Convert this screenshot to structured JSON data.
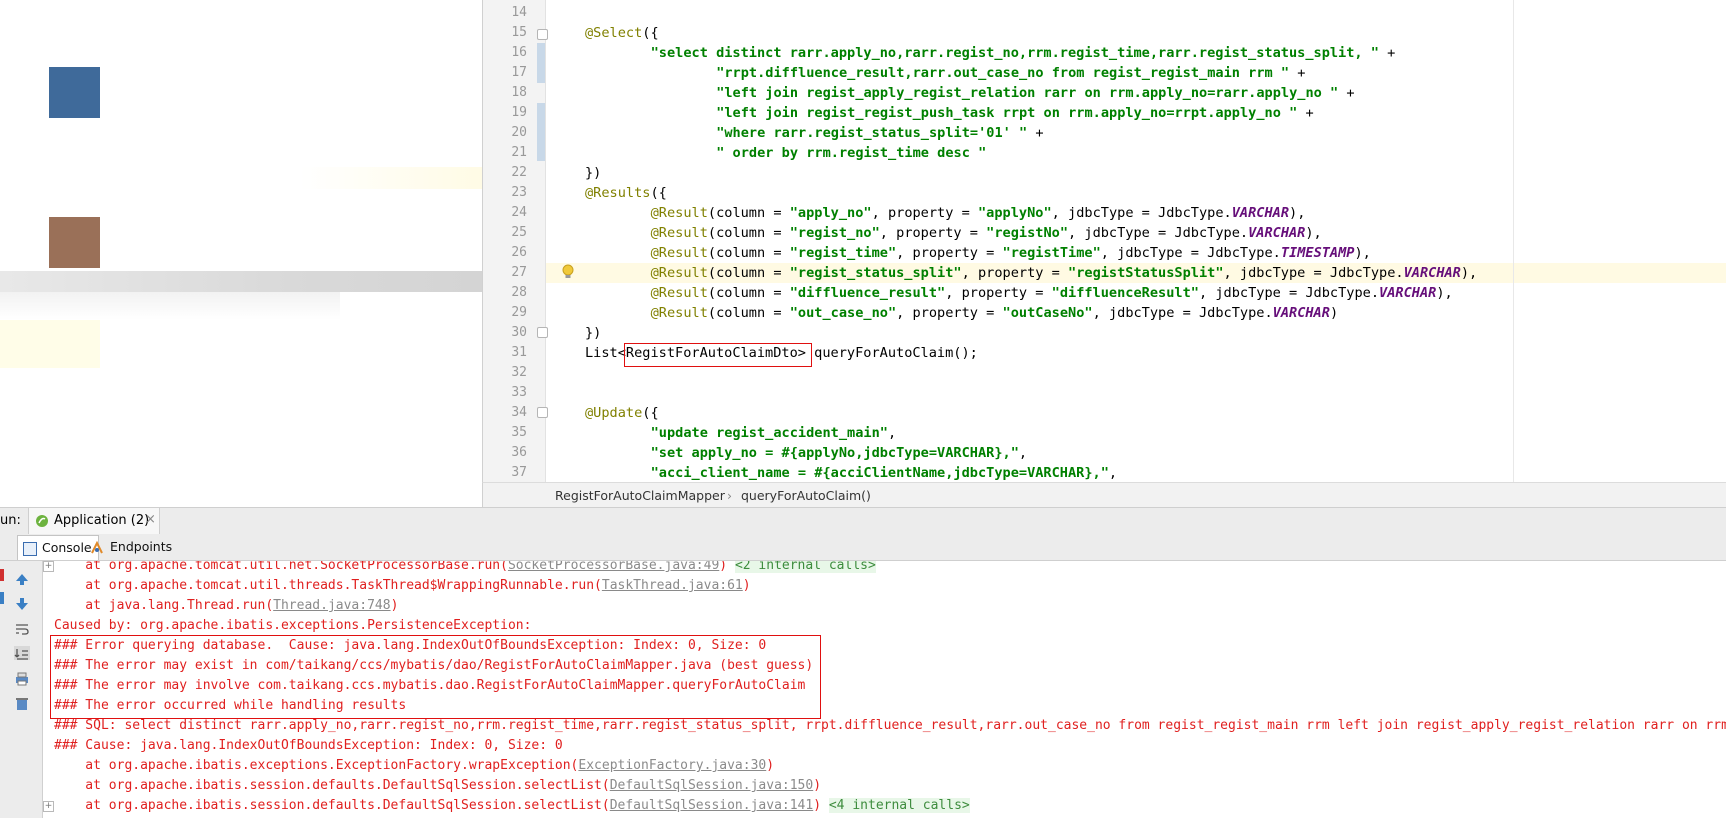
{
  "editor": {
    "lines": [
      {
        "n": "14",
        "parts": []
      },
      {
        "n": "15",
        "parts": [
          {
            "t": "@Select",
            "c": "ann"
          },
          {
            "t": "({",
            "c": ""
          }
        ]
      },
      {
        "n": "16",
        "indent": 8,
        "parts": [
          {
            "t": "\"select distinct rarr.apply_no,rarr.regist_no,rrm.regist_time,rarr.regist_status_split, \"",
            "c": "str"
          },
          {
            "t": " +",
            "c": ""
          }
        ]
      },
      {
        "n": "17",
        "indent": 16,
        "parts": [
          {
            "t": "\"rrpt.diffluence_result,rarr.out_case_no from regist_regist_main rrm \"",
            "c": "str"
          },
          {
            "t": " +",
            "c": ""
          }
        ]
      },
      {
        "n": "18",
        "indent": 16,
        "parts": [
          {
            "t": "\"left join regist_apply_regist_relation rarr on rrm.apply_no=rarr.apply_no \"",
            "c": "str"
          },
          {
            "t": " +",
            "c": ""
          }
        ]
      },
      {
        "n": "19",
        "indent": 16,
        "parts": [
          {
            "t": "\"left join regist_regist_push_task rrpt on rrm.apply_no=rrpt.apply_no \"",
            "c": "str"
          },
          {
            "t": " +",
            "c": ""
          }
        ]
      },
      {
        "n": "20",
        "indent": 16,
        "parts": [
          {
            "t": "\"where rarr.regist_status_split='01' \"",
            "c": "str"
          },
          {
            "t": " +",
            "c": ""
          }
        ]
      },
      {
        "n": "21",
        "indent": 16,
        "parts": [
          {
            "t": "\" order by rrm.regist_time desc \"",
            "c": "str"
          }
        ]
      },
      {
        "n": "22",
        "parts": [
          {
            "t": "})",
            "c": ""
          }
        ]
      },
      {
        "n": "23",
        "parts": [
          {
            "t": "@Results",
            "c": "ann"
          },
          {
            "t": "({",
            "c": ""
          }
        ]
      },
      {
        "n": "24",
        "indent": 8,
        "parts": [
          {
            "t": "@Result",
            "c": "ann"
          },
          {
            "t": "(column = ",
            "c": ""
          },
          {
            "t": "\"apply_no\"",
            "c": "str"
          },
          {
            "t": ", property = ",
            "c": ""
          },
          {
            "t": "\"applyNo\"",
            "c": "str"
          },
          {
            "t": ", jdbcType = JdbcType.",
            "c": ""
          },
          {
            "t": "VARCHAR",
            "c": "const"
          },
          {
            "t": "),",
            "c": ""
          }
        ]
      },
      {
        "n": "25",
        "indent": 8,
        "parts": [
          {
            "t": "@Result",
            "c": "ann"
          },
          {
            "t": "(column = ",
            "c": ""
          },
          {
            "t": "\"regist_no\"",
            "c": "str"
          },
          {
            "t": ", property = ",
            "c": ""
          },
          {
            "t": "\"registNo\"",
            "c": "str"
          },
          {
            "t": ", jdbcType = JdbcType.",
            "c": ""
          },
          {
            "t": "VARCHAR",
            "c": "const"
          },
          {
            "t": "),",
            "c": ""
          }
        ]
      },
      {
        "n": "26",
        "indent": 8,
        "parts": [
          {
            "t": "@Result",
            "c": "ann"
          },
          {
            "t": "(column = ",
            "c": ""
          },
          {
            "t": "\"regist_time\"",
            "c": "str"
          },
          {
            "t": ", property = ",
            "c": ""
          },
          {
            "t": "\"registTime\"",
            "c": "str"
          },
          {
            "t": ", jdbcType = JdbcType.",
            "c": ""
          },
          {
            "t": "TIMESTAMP",
            "c": "const"
          },
          {
            "t": "),",
            "c": ""
          }
        ]
      },
      {
        "n": "27",
        "indent": 8,
        "parts": [
          {
            "t": "@Result",
            "c": "ann"
          },
          {
            "t": "(column = ",
            "c": ""
          },
          {
            "t": "\"regist_status_split\"",
            "c": "str"
          },
          {
            "t": ", property = ",
            "c": ""
          },
          {
            "t": "\"registStatusSplit\"",
            "c": "str"
          },
          {
            "t": ", jdbcType = JdbcType.",
            "c": ""
          },
          {
            "t": "VARCHAR",
            "c": "const"
          },
          {
            "t": "),",
            "c": ""
          }
        ]
      },
      {
        "n": "28",
        "indent": 8,
        "parts": [
          {
            "t": "@Result",
            "c": "ann"
          },
          {
            "t": "(column = ",
            "c": ""
          },
          {
            "t": "\"diffluence_result\"",
            "c": "str"
          },
          {
            "t": ", property = ",
            "c": ""
          },
          {
            "t": "\"diffluenceResult\"",
            "c": "str"
          },
          {
            "t": ", jdbcType = JdbcType.",
            "c": ""
          },
          {
            "t": "VARCHAR",
            "c": "const"
          },
          {
            "t": "),",
            "c": ""
          }
        ]
      },
      {
        "n": "29",
        "indent": 8,
        "parts": [
          {
            "t": "@Result",
            "c": "ann"
          },
          {
            "t": "(column = ",
            "c": ""
          },
          {
            "t": "\"out_case_no\"",
            "c": "str"
          },
          {
            "t": ", property = ",
            "c": ""
          },
          {
            "t": "\"outCaseNo\"",
            "c": "str"
          },
          {
            "t": ", jdbcType = JdbcType.",
            "c": ""
          },
          {
            "t": "VARCHAR",
            "c": "const"
          },
          {
            "t": ")",
            "c": ""
          }
        ]
      },
      {
        "n": "30",
        "parts": [
          {
            "t": "})",
            "c": ""
          }
        ]
      },
      {
        "n": "31",
        "parts": [
          {
            "t": "List<",
            "c": ""
          },
          {
            "t": "RegistForAutoClaimDto",
            "c": ""
          },
          {
            "t": "> queryForAutoClaim();",
            "c": ""
          }
        ]
      },
      {
        "n": "32",
        "parts": []
      },
      {
        "n": "33",
        "parts": []
      },
      {
        "n": "34",
        "parts": [
          {
            "t": "@Update",
            "c": "ann"
          },
          {
            "t": "({",
            "c": ""
          }
        ]
      },
      {
        "n": "35",
        "indent": 8,
        "parts": [
          {
            "t": "\"update regist_accident_main\"",
            "c": "str"
          },
          {
            "t": ",",
            "c": ""
          }
        ]
      },
      {
        "n": "36",
        "indent": 8,
        "parts": [
          {
            "t": "\"set apply_no = #{applyNo,jdbcType=VARCHAR},\"",
            "c": "str"
          },
          {
            "t": ",",
            "c": ""
          }
        ]
      },
      {
        "n": "37",
        "indent": 8,
        "parts": [
          {
            "t": "\"acci_client_name = #{acciClientName,jdbcType=VARCHAR},\"",
            "c": "str"
          },
          {
            "t": ",",
            "c": ""
          }
        ]
      }
    ]
  },
  "breadcrumb": {
    "items": [
      "RegistForAutoClaimMapper",
      "queryForAutoClaim()"
    ],
    "separator": "›"
  },
  "run": {
    "label": "un:",
    "app_tab": "Application (2)",
    "close": "×"
  },
  "tabs": {
    "console": "Console",
    "endpoints": "Endpoints"
  },
  "console": {
    "lines": [
      {
        "parts": [
          {
            "t": "    at org.apache.tomcat.util.net.SocketProcessorBase.run(",
            "c": ""
          },
          {
            "t": "SocketProcessorBase.java:49",
            "c": "link"
          },
          {
            "t": ") ",
            "c": ""
          },
          {
            "t": "<2 internal calls>",
            "c": "internal"
          }
        ],
        "fold": true
      },
      {
        "parts": [
          {
            "t": "    at org.apache.tomcat.util.threads.TaskThread$WrappingRunnable.run(",
            "c": ""
          },
          {
            "t": "TaskThread.java:61",
            "c": "link"
          },
          {
            "t": ")",
            "c": ""
          }
        ]
      },
      {
        "parts": [
          {
            "t": "    at java.lang.Thread.run(",
            "c": ""
          },
          {
            "t": "Thread.java:748",
            "c": "link"
          },
          {
            "t": ")",
            "c": ""
          }
        ]
      },
      {
        "parts": [
          {
            "t": "Caused by: org.apache.ibatis.exceptions.PersistenceException:",
            "c": ""
          }
        ]
      },
      {
        "parts": [
          {
            "t": "### Error querying database.  Cause: java.lang.IndexOutOfBoundsException: Index: 0, Size: 0",
            "c": ""
          }
        ]
      },
      {
        "parts": [
          {
            "t": "### The error may exist in com/taikang/ccs/mybatis/dao/RegistForAutoClaimMapper.java (best guess)",
            "c": ""
          }
        ]
      },
      {
        "parts": [
          {
            "t": "### The error may involve com.taikang.ccs.mybatis.dao.RegistForAutoClaimMapper.queryForAutoClaim",
            "c": ""
          }
        ]
      },
      {
        "parts": [
          {
            "t": "### The error occurred while handling results",
            "c": ""
          }
        ]
      },
      {
        "parts": [
          {
            "t": "### SQL: select distinct rarr.apply_no,rarr.regist_no,rrm.regist_time,rarr.regist_status_split, rrpt.diffluence_result,rarr.out_case_no from regist_regist_main rrm left join regist_apply_regist_relation rarr on rrm.apply_no=rarr.apply_no",
            "c": ""
          }
        ]
      },
      {
        "parts": [
          {
            "t": "### Cause: java.lang.IndexOutOfBoundsException: Index: 0, Size: 0",
            "c": ""
          }
        ]
      },
      {
        "parts": [
          {
            "t": "    at org.apache.ibatis.exceptions.ExceptionFactory.wrapException(",
            "c": ""
          },
          {
            "t": "ExceptionFactory.java:30",
            "c": "link"
          },
          {
            "t": ")",
            "c": ""
          }
        ]
      },
      {
        "parts": [
          {
            "t": "    at org.apache.ibatis.session.defaults.DefaultSqlSession.selectList(",
            "c": ""
          },
          {
            "t": "DefaultSqlSession.java:150",
            "c": "link"
          },
          {
            "t": ")",
            "c": ""
          }
        ]
      },
      {
        "parts": [
          {
            "t": "    at org.apache.ibatis.session.defaults.DefaultSqlSession.selectList(",
            "c": ""
          },
          {
            "t": "DefaultSqlSession.java:141",
            "c": "link"
          },
          {
            "t": ") ",
            "c": ""
          },
          {
            "t": "<4 internal calls>",
            "c": "internal"
          }
        ],
        "fold": true
      }
    ]
  },
  "colors": {
    "swatch_blue": "#3f6a9a",
    "swatch_brown": "#9a7058",
    "error_red": "#e0201f",
    "box_red": "#e01010"
  }
}
